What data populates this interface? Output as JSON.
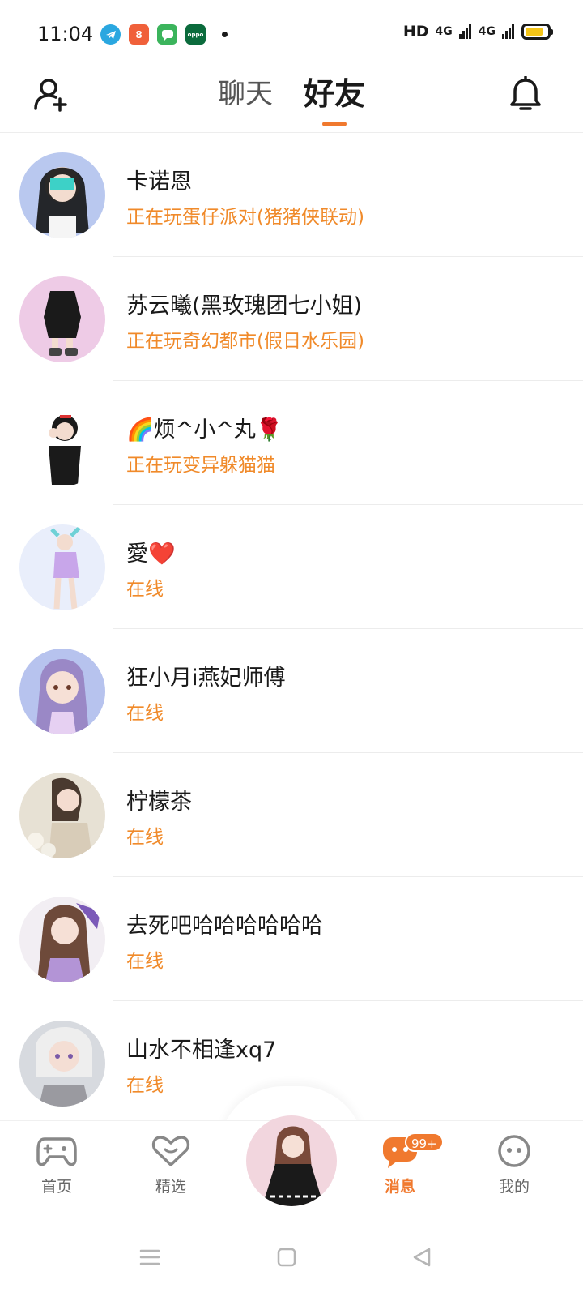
{
  "status_bar": {
    "time": "11:04",
    "network_label": "HD",
    "signal1": "4G",
    "signal2": "4G",
    "notif_kuai": "8",
    "notif_oppo": "oppo"
  },
  "header": {
    "tabs": [
      {
        "label": "聊天",
        "active": false
      },
      {
        "label": "好友",
        "active": true
      }
    ]
  },
  "friends": [
    {
      "name": "卡诺恩",
      "status": "正在玩蛋仔派对(猪猪侠联动)"
    },
    {
      "name": "苏云曦(黑玫瑰团七小姐)",
      "status": "正在玩奇幻都市(假日水乐园)"
    },
    {
      "name": "🌈烦^小^丸🌹",
      "status": "正在玩变异躲猫猫"
    },
    {
      "name": "愛❤️",
      "status": "在线"
    },
    {
      "name": "狂小月i燕妃师傅",
      "status": "在线"
    },
    {
      "name": "柠檬茶",
      "status": "在线"
    },
    {
      "name": "去死吧哈哈哈哈哈哈",
      "status": "在线"
    },
    {
      "name": "山水不相逢xq7",
      "status": "在线"
    }
  ],
  "bottom_nav": {
    "home": "首页",
    "featured": "精选",
    "messages": "消息",
    "messages_badge": "99+",
    "mine": "我的"
  },
  "colors": {
    "accent": "#f0792e",
    "status_text": "#f08a2a"
  }
}
